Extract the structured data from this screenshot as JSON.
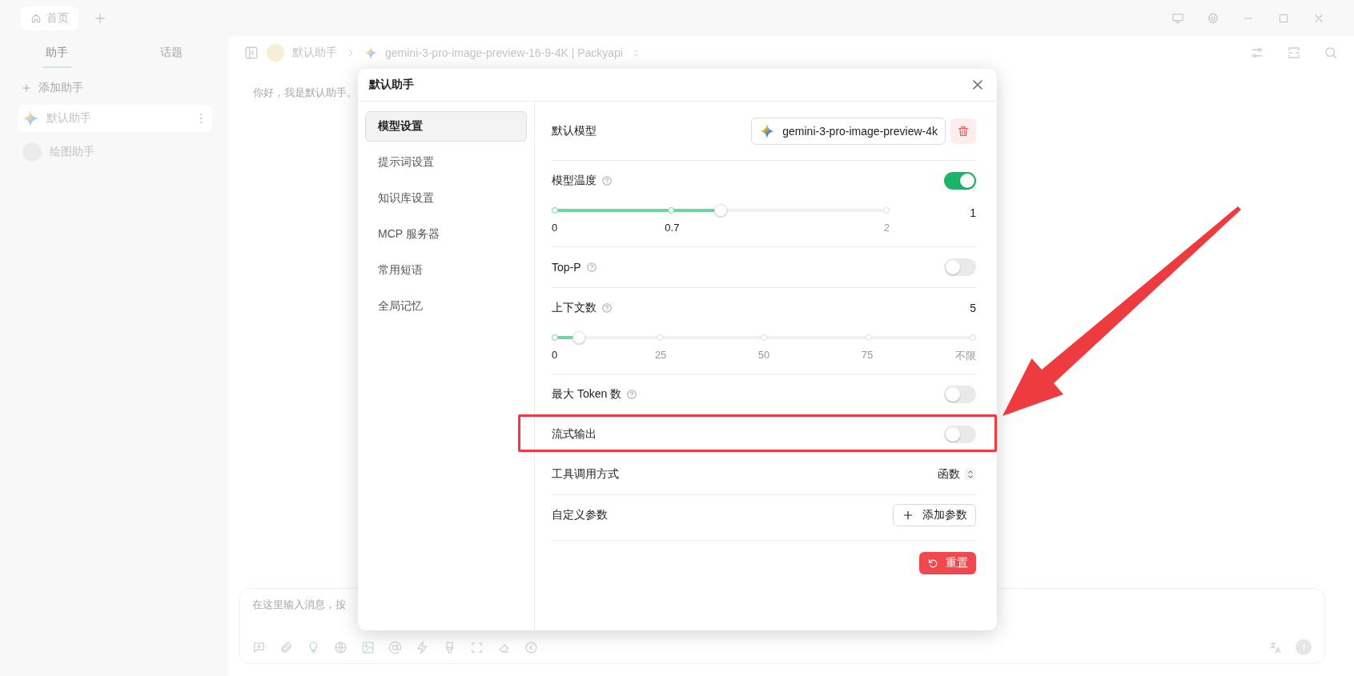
{
  "titlebar": {
    "tabs": [
      {
        "label": "首页",
        "selected": true
      }
    ]
  },
  "sidebar": {
    "tabs": [
      {
        "label": "助手",
        "selected": true
      },
      {
        "label": "话题",
        "selected": false
      }
    ],
    "add_label": "添加助手",
    "assistants": [
      {
        "name": "默认助手",
        "selected": true,
        "kind": "gemini"
      },
      {
        "name": "绘图助手",
        "selected": false,
        "kind": "avatar"
      }
    ]
  },
  "chat": {
    "assistant": "默认助手",
    "model": "gemini-3-pro-image-preview-16-9-4K | Packyapi",
    "greeting": "你好，我是默认助手。",
    "input_placeholder": "在这里输入消息，按"
  },
  "dialog": {
    "title": "默认助手",
    "nav": [
      {
        "label": "模型设置",
        "selected": true
      },
      {
        "label": "提示词设置",
        "selected": false
      },
      {
        "label": "知识库设置",
        "selected": false
      },
      {
        "label": "MCP 服务器",
        "selected": false
      },
      {
        "label": "常用短语",
        "selected": false
      },
      {
        "label": "全局记忆",
        "selected": false
      }
    ],
    "groups": [
      {
        "rows": [
          {
            "kind": "model",
            "label": "默认模型",
            "value": "gemini-3-pro-image-preview-4k"
          }
        ]
      },
      {
        "rows": [
          {
            "kind": "toggle_slider",
            "label": "模型温度",
            "on": true,
            "reading": "1",
            "slider": {
              "level": 0.5,
              "marks": [
                {
                  "label": "0",
                  "level": 0
                },
                {
                  "label": "0.7",
                  "level": 0.35
                },
                {
                  "label": "2",
                  "level": 1
                }
              ]
            }
          }
        ]
      },
      {
        "rows": [
          {
            "kind": "toggle",
            "label": "Top-P",
            "on": false
          }
        ]
      },
      {
        "rows": [
          {
            "kind": "slider",
            "label": "上下文数",
            "reading": "5",
            "slider": {
              "level": 0.05,
              "marks": [
                {
                  "label": "0",
                  "level": 0
                },
                {
                  "label": "25",
                  "level": 0.25
                },
                {
                  "label": "50",
                  "level": 0.5
                },
                {
                  "label": "75",
                  "level": 0.75
                },
                {
                  "label": "不限",
                  "level": 1
                }
              ]
            }
          }
        ]
      },
      {
        "rows": [
          {
            "kind": "toggle",
            "label": "最大 Token 数",
            "on": false
          },
          {
            "kind": "toggle",
            "label": "流式输出",
            "on": false,
            "annotated": true
          },
          {
            "kind": "select",
            "label": "工具调用方式",
            "value": "函数"
          }
        ]
      },
      {
        "rows": [
          {
            "kind": "button",
            "label": "自定义参数",
            "button": "添加参数"
          }
        ]
      }
    ],
    "reset": "重置"
  }
}
